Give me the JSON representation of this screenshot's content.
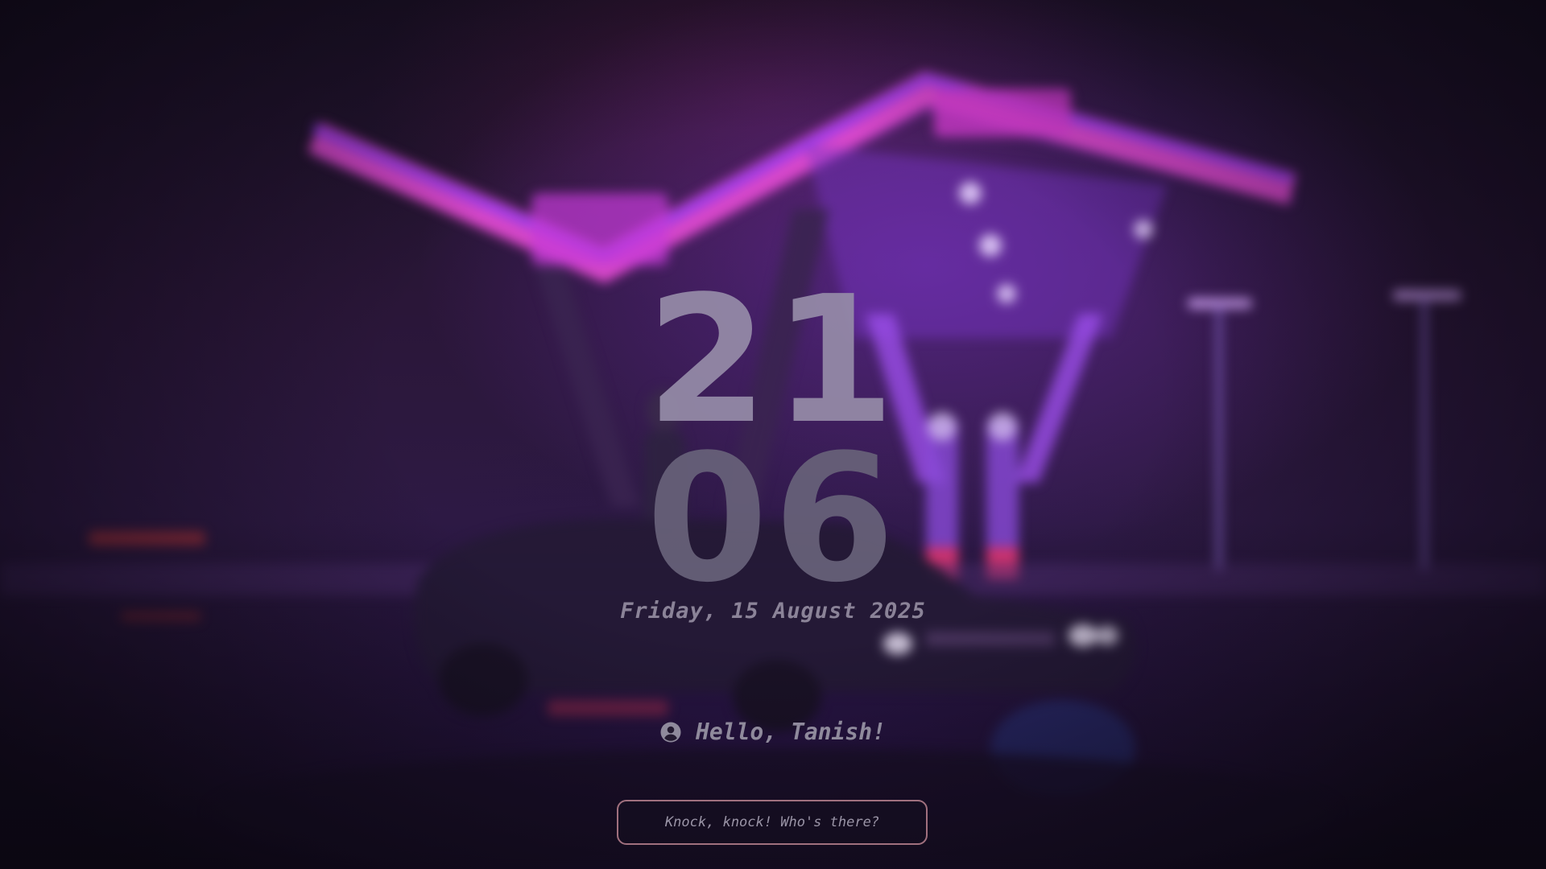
{
  "lockscreen": {
    "time_hours": "21",
    "time_minutes": "06",
    "date": "Friday, 15 August 2025",
    "greeting": "Hello, Tanish!",
    "password_placeholder": "Knock, knock! Who's there?"
  },
  "icons": {
    "user": "user-circle-icon"
  },
  "colors": {
    "hours": "#968ca8",
    "minutes": "#666078",
    "text": "#8b8398",
    "input_border": "#a0707e",
    "neon_pink": "#e040c8",
    "neon_purple": "#9a3cf0"
  }
}
